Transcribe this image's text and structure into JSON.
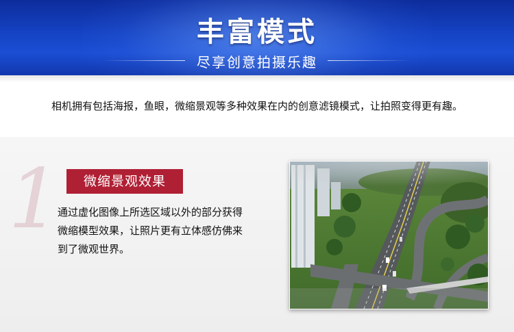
{
  "banner": {
    "title": "丰富模式",
    "subtitle": "尽享创意拍摄乐趣"
  },
  "description": "相机拥有包括海报，鱼眼，微缩景观等多种效果在内的创意滤镜模式，让拍照变得更有趣。",
  "feature": {
    "number": "1",
    "badge": "微缩景观效果",
    "lines": [
      "通过虚化图像上所选区域以外的部分获得",
      "微缩模型效果，让照片更有立体感仿佛来",
      "到了微观世界。"
    ],
    "photo_icon": "miniature-city-highway-photo"
  },
  "colors": {
    "banner_blue": "#1543c4",
    "badge_red": "#b02035"
  }
}
